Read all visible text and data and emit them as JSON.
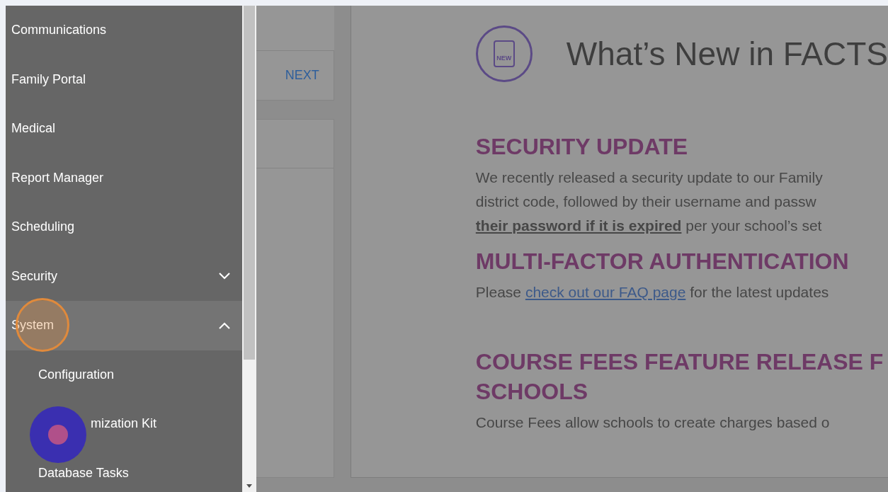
{
  "sidebar": {
    "items": [
      {
        "label": "Communications"
      },
      {
        "label": "Family Portal"
      },
      {
        "label": "Medical"
      },
      {
        "label": "Report Manager"
      },
      {
        "label": "Scheduling"
      },
      {
        "label": "Security",
        "expanded": false
      },
      {
        "label": "System",
        "expanded": true,
        "highlighted": true,
        "children": [
          {
            "label": "Configuration",
            "pointer": false
          },
          {
            "label": "mization Kit",
            "pointer": true
          },
          {
            "label": "Database Tasks",
            "pointer": false
          }
        ]
      }
    ]
  },
  "side_panel": {
    "next_button": "NEXT"
  },
  "news": {
    "title": "What’s New in FACTS",
    "badge": "NEW",
    "sections": [
      {
        "heading_lines": [
          "SECURITY UPDATE"
        ],
        "lines": [
          {
            "text": "We recently released a security update to our Family"
          },
          {
            "text": "district code, followed by their username and passw"
          },
          {
            "text": "**their password if it is expired** per your school’s set"
          }
        ]
      },
      {
        "heading_lines": [
          "MULTI-FACTOR AUTHENTICATION"
        ],
        "lines": [
          {
            "text": "Please ",
            "link": "check out our FAQ page",
            "after": " for the latest updates"
          }
        ]
      },
      {
        "heading_lines": [
          "COURSE FEES FEATURE RELEASE F",
          "SCHOOLS"
        ],
        "lines": [
          {
            "text": "Course Fees allow schools to create charges based o"
          }
        ]
      }
    ]
  }
}
